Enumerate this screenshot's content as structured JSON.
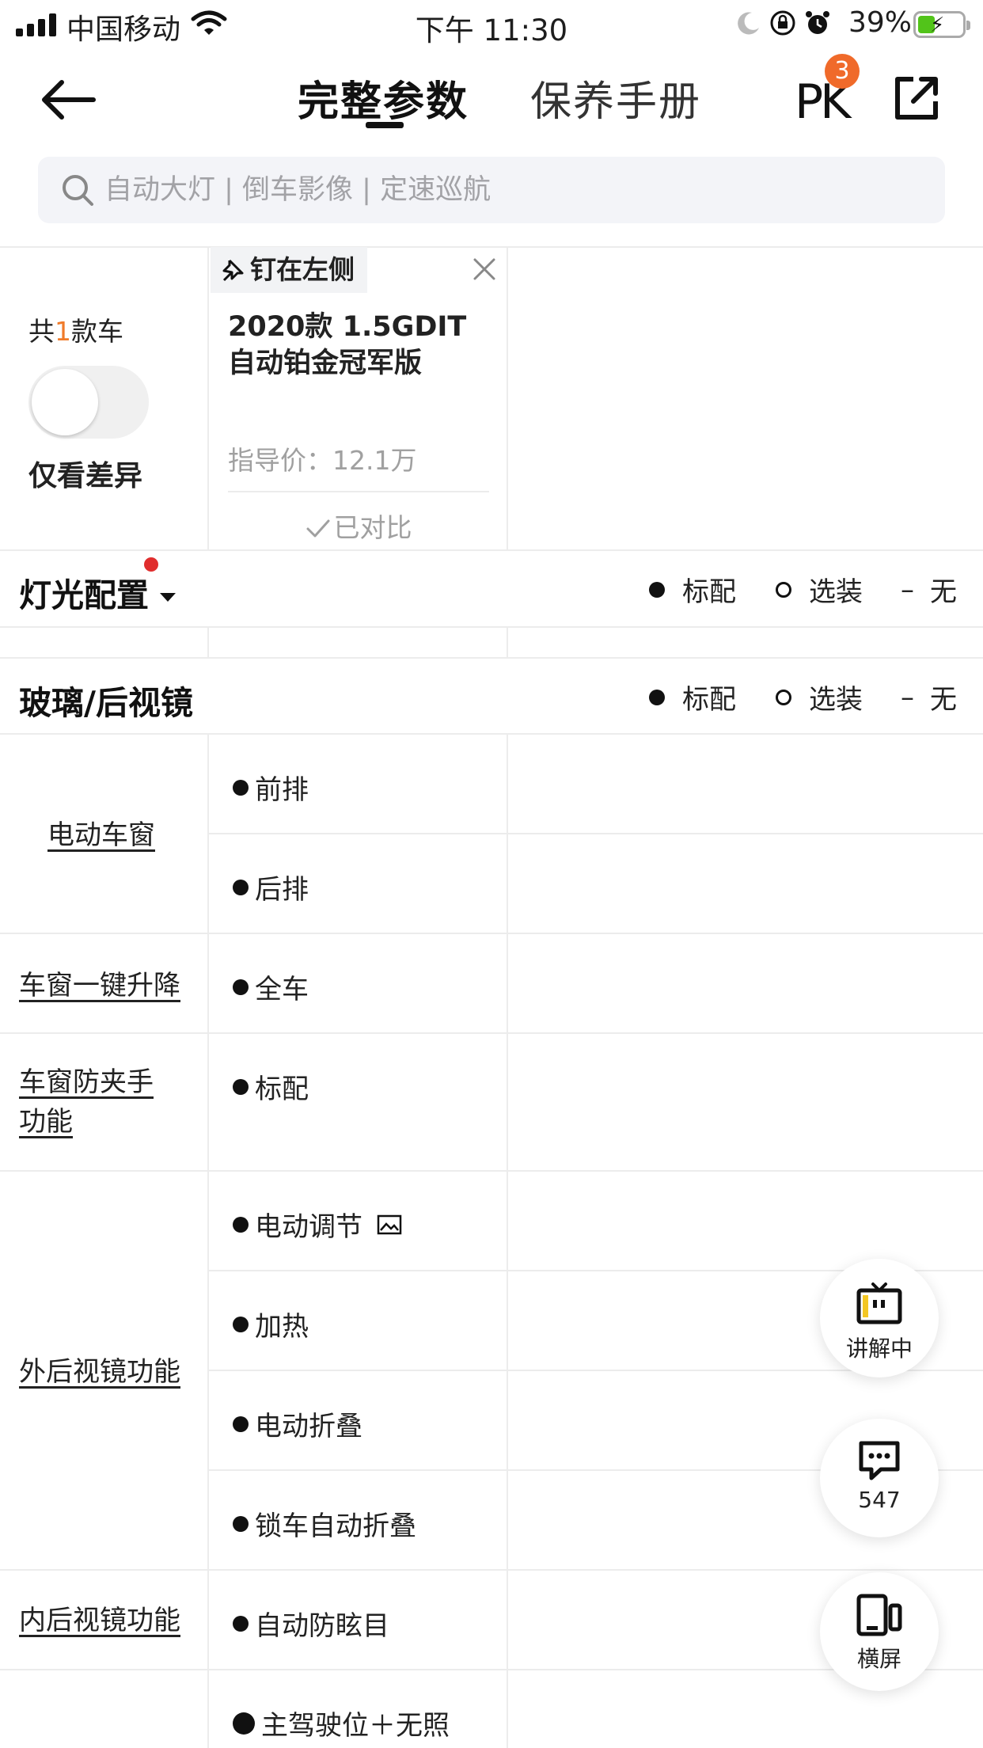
{
  "status_bar": {
    "carrier": "中国移动",
    "time": "下午 11:30",
    "battery_percent": "39%",
    "battery_level": 0.39,
    "battery_color": "#52c41a"
  },
  "nav": {
    "tabs": [
      {
        "label": "完整参数",
        "active": true
      },
      {
        "label": "保养手册",
        "active": false
      }
    ],
    "pk_label": "PK",
    "pk_badge": "3",
    "pk_badge_color": "#f06a2a"
  },
  "search": {
    "placeholder": "自动大灯 | 倒车影像 | 定速巡航"
  },
  "header": {
    "count_prefix": "共",
    "count_num": "1",
    "count_suffix": "款车",
    "count_color": "#f07b2a",
    "diff_toggle": {
      "label": "仅看差异",
      "on": false
    },
    "pin_label": "钉在左侧",
    "car_name": "2020款 1.5GDIT 自动铂金冠军版",
    "car_price": "指导价：12.1万",
    "compared_label": "已对比"
  },
  "legend": {
    "standard": "标配",
    "optional": "选装",
    "none_symbol": "–",
    "none": "无"
  },
  "sections": [
    {
      "title": "灯光配置",
      "has_dropdown": true,
      "notification_dot_color": "#e02d2d"
    },
    {
      "title": "玻璃/后视镜",
      "has_dropdown": false
    }
  ],
  "params": [
    {
      "label": "电动车窗",
      "values": [
        "前排",
        "后排"
      ]
    },
    {
      "label": "车窗一键升降",
      "values": [
        "全车"
      ]
    },
    {
      "label": "车窗防夹手功能",
      "values": [
        "标配"
      ]
    },
    {
      "label": "外后视镜功能",
      "values": [
        "电动调节",
        "加热",
        "电动折叠",
        "锁车自动折叠"
      ]
    },
    {
      "label": "内后视镜功能",
      "values": [
        "自动防眩目"
      ]
    },
    {
      "label": "",
      "values": [
        "主驾驶位＋无照"
      ]
    }
  ],
  "float_buttons": {
    "live_label": "讲解中",
    "comments_count": "547",
    "landscape_label": "横屏"
  }
}
